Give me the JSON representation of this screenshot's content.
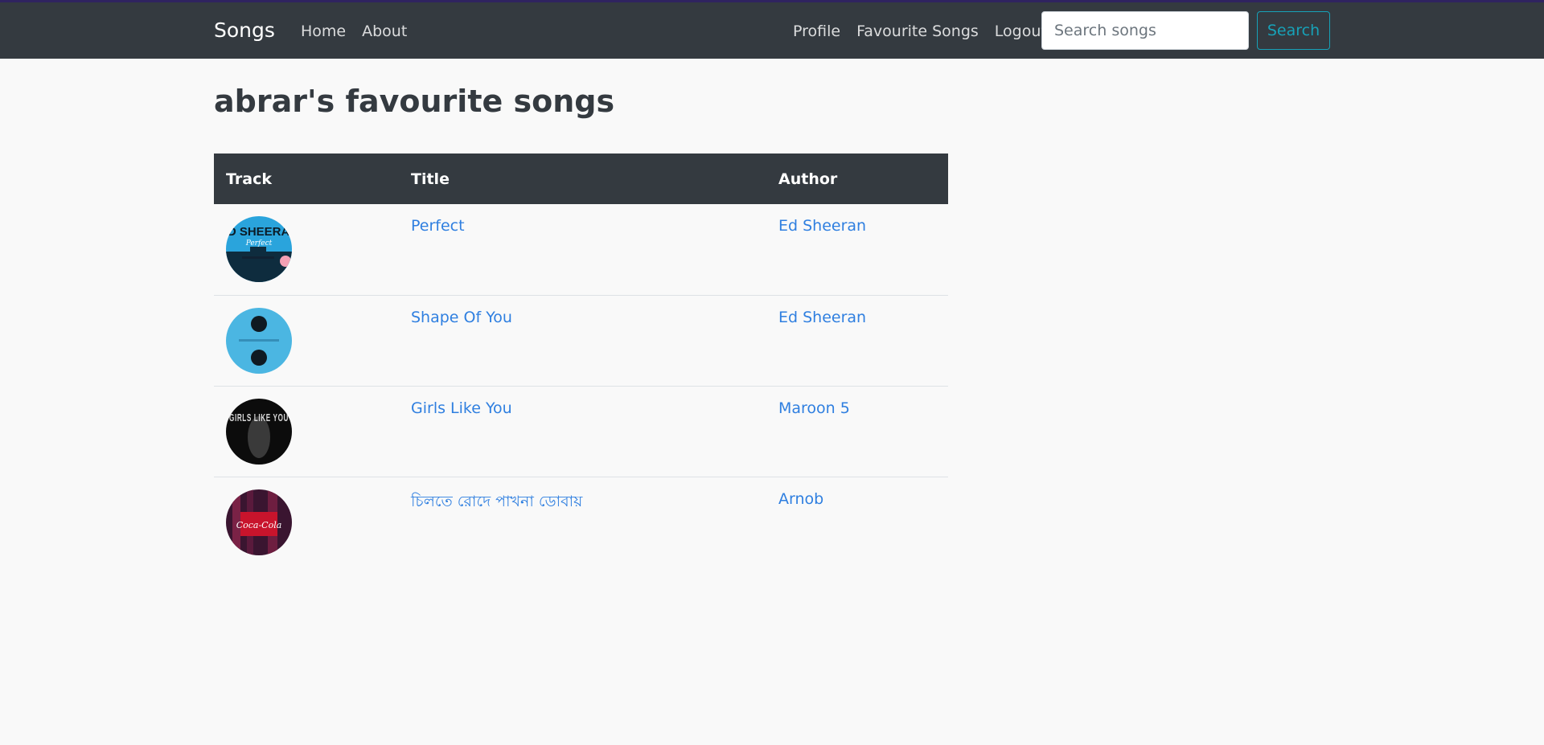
{
  "nav": {
    "brand": "Songs",
    "left_links": [
      "Home",
      "About"
    ],
    "right_links": [
      "Profile",
      "Favourite Songs",
      "Logout"
    ],
    "search_placeholder": "Search songs",
    "search_button": "Search"
  },
  "page": {
    "title": "abrar's favourite songs"
  },
  "table": {
    "headers": {
      "track": "Track",
      "title": "Title",
      "author": "Author"
    },
    "rows": [
      {
        "title": "Perfect",
        "author": "Ed Sheeran",
        "cover_icon": "perfect-album-cover-icon",
        "cover_text": "ED SHEERAN",
        "cover_subtext": "Perfect"
      },
      {
        "title": "Shape Of You",
        "author": "Ed Sheeran",
        "cover_icon": "divide-album-cover-icon"
      },
      {
        "title": "Girls Like You",
        "author": "Maroon 5",
        "cover_icon": "girls-like-you-cover-icon",
        "cover_text": "GIRLS LIKE YOU"
      },
      {
        "title": "চিলতে রোদে পাখনা ডোবায়",
        "author": "Arnob",
        "cover_icon": "coke-studio-cover-icon",
        "cover_text": "Coca-Cola"
      }
    ]
  },
  "colors": {
    "navbar": "#343a40",
    "accent_link": "#2f7fe0",
    "search_button": "#17a2b8",
    "page_background": "#f9f9f9"
  }
}
